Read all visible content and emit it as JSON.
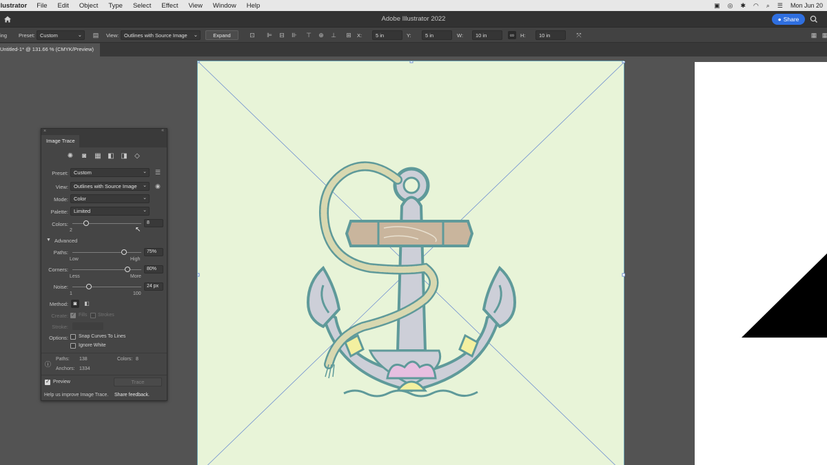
{
  "menubar": {
    "app": "llustrator",
    "items": [
      "File",
      "Edit",
      "Object",
      "Type",
      "Select",
      "Effect",
      "View",
      "Window",
      "Help"
    ],
    "clock": "Mon Jun 20"
  },
  "titlebar": {
    "title": "Adobe Illustrator 2022",
    "share_label": "Share"
  },
  "controlbar": {
    "left_fragment": "ing",
    "preset_label": "Preset:",
    "preset_value": "Custom",
    "view_label": "View:",
    "view_value": "Outlines with Source Image",
    "expand_label": "Expand",
    "x_label": "X:",
    "x_value": "5 in",
    "y_label": "Y:",
    "y_value": "5 in",
    "w_label": "W:",
    "w_value": "10 in",
    "h_label": "H:",
    "h_value": "10 in"
  },
  "document_tab": {
    "label": "Untitled-1* @ 131.66 % (CMYK/Preview)"
  },
  "panel": {
    "title": "Image Trace",
    "preset_label": "Preset:",
    "preset_value": "Custom",
    "view_label": "View:",
    "view_value": "Outlines with Source Image",
    "mode_label": "Mode:",
    "mode_value": "Color",
    "palette_label": "Palette:",
    "palette_value": "Limited",
    "colors_label": "Colors:",
    "colors_value": "8",
    "colors_min": "2",
    "colors_level": 0.2,
    "advanced_label": "Advanced",
    "paths_label": "Paths:",
    "paths_value": "75%",
    "paths_low": "Low",
    "paths_high": "High",
    "paths_level": 0.75,
    "corners_label": "Corners:",
    "corners_value": "80%",
    "corners_less": "Less",
    "corners_more": "More",
    "corners_level": 0.8,
    "noise_label": "Noise:",
    "noise_value": "24 px",
    "noise_min": "1",
    "noise_max": "100",
    "noise_level": 0.24,
    "method_label": "Method:",
    "create_label": "Create:",
    "fills_label": "Fills",
    "strokes_label": "Strokes",
    "stroke_label": "Stroke:",
    "options_label": "Options:",
    "snap_label": "Snap Curves To Lines",
    "ignore_white_label": "Ignore White",
    "paths_stat_label": "Paths:",
    "paths_stat_value": "138",
    "colors_stat_label": "Colors:",
    "colors_stat_value": "8",
    "anchors_stat_label": "Anchors:",
    "anchors_stat_value": "1334",
    "preview_label": "Preview",
    "trace_label": "Trace",
    "feedback_text": "Help us improve Image Trace.",
    "feedback_link": "Share feedback."
  },
  "colors": {
    "artboard_bg": "#e8f4d8",
    "outline": "#5f9a9a",
    "rope": "#d8d8b0",
    "anchor_fill": "#cdcfd8",
    "wood": "#c9b59d",
    "yellow": "#f3f0a0",
    "pink": "#e7bfe0",
    "accent_blue": "#2f6fe0",
    "guide": "#6f8fd0"
  }
}
